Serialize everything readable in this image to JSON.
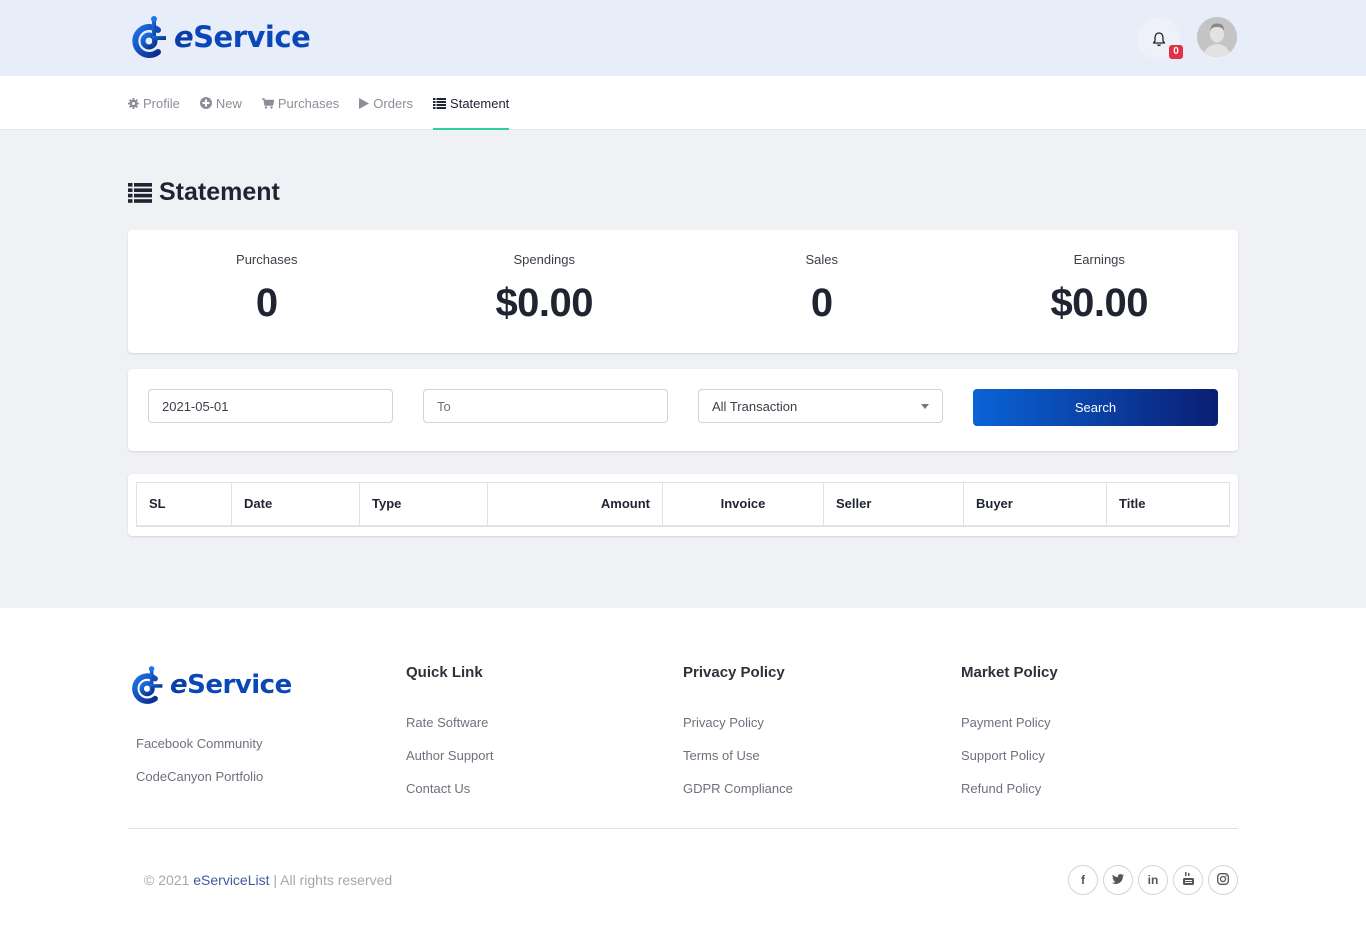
{
  "brand": {
    "name_prefix": "e",
    "name_rest": "Service",
    "color": "#0a47b8"
  },
  "header": {
    "notification_count": "0",
    "notification_badge_color": "#e03244"
  },
  "nav": {
    "items": [
      {
        "label": "Profile",
        "icon": "gear-icon",
        "active": false
      },
      {
        "label": "New",
        "icon": "plus-circle-icon",
        "active": false
      },
      {
        "label": "Purchases",
        "icon": "cart-icon",
        "active": false
      },
      {
        "label": "Orders",
        "icon": "play-icon",
        "active": false
      },
      {
        "label": "Statement",
        "icon": "list-icon",
        "active": true
      }
    ],
    "active_color": "#2ed296"
  },
  "page": {
    "title": "Statement",
    "title_icon": "list-icon"
  },
  "stats": [
    {
      "label": "Purchases",
      "value": "0"
    },
    {
      "label": "Spendings",
      "value": "$0.00"
    },
    {
      "label": "Sales",
      "value": "0"
    },
    {
      "label": "Earnings",
      "value": "$0.00"
    }
  ],
  "filters": {
    "from_value": "2021-05-01",
    "to_placeholder": "To",
    "type_selected": "All Transaction",
    "search_label": "Search"
  },
  "table": {
    "columns": [
      "SL",
      "Date",
      "Type",
      "Amount",
      "Invoice",
      "Seller",
      "Buyer",
      "Title"
    ],
    "rows": []
  },
  "footer": {
    "left_links": [
      "Facebook Community",
      "CodeCanyon Portfolio"
    ],
    "columns": [
      {
        "heading": "Quick Link",
        "links": [
          "Rate Software",
          "Author Support",
          "Contact Us"
        ]
      },
      {
        "heading": "Privacy Policy",
        "links": [
          "Privacy Policy",
          "Terms of Use",
          "GDPR Compliance"
        ]
      },
      {
        "heading": "Market Policy",
        "links": [
          "Payment Policy",
          "Support Policy",
          "Refund Policy"
        ]
      }
    ],
    "copyright_prefix": "© 2021 ",
    "copyright_link": "eServiceList",
    "copyright_suffix": " | All rights reserved",
    "socials": [
      {
        "name": "facebook-icon",
        "glyph": "f"
      },
      {
        "name": "twitter-icon",
        "glyph": "t"
      },
      {
        "name": "linkedin-icon",
        "glyph": "in"
      },
      {
        "name": "youtube-icon",
        "glyph": "▶"
      },
      {
        "name": "instagram-icon",
        "glyph": "◎"
      }
    ]
  }
}
